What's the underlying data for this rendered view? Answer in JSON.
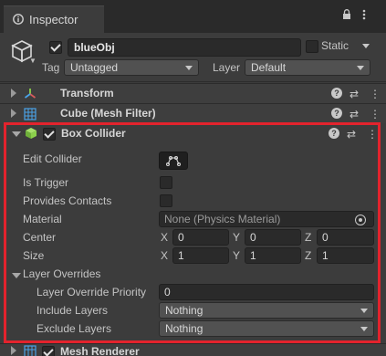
{
  "tab": {
    "title": "Inspector"
  },
  "object": {
    "name": "blueObj",
    "static_label": "Static",
    "tag_label": "Tag",
    "tag_value": "Untagged",
    "layer_label": "Layer",
    "layer_value": "Default"
  },
  "components": [
    {
      "title": "Transform"
    },
    {
      "title": "Cube (Mesh Filter)"
    }
  ],
  "box_collider": {
    "title": "Box Collider",
    "edit_collider_label": "Edit Collider",
    "is_trigger_label": "Is Trigger",
    "provides_contacts_label": "Provides Contacts",
    "material_label": "Material",
    "material_value": "None (Physics Material)",
    "center_label": "Center",
    "center": {
      "x": "0",
      "y": "0",
      "z": "0"
    },
    "size_label": "Size",
    "size": {
      "x": "1",
      "y": "1",
      "z": "1"
    },
    "axis_labels": {
      "x": "X",
      "y": "Y",
      "z": "Z"
    },
    "layer_overrides_label": "Layer Overrides",
    "priority_label": "Layer Override Priority",
    "priority_value": "0",
    "include_label": "Include Layers",
    "include_value": "Nothing",
    "exclude_label": "Exclude Layers",
    "exclude_value": "Nothing"
  },
  "mesh_renderer": {
    "title": "Mesh Renderer"
  },
  "colors": {
    "accent_highlight": "#e3232d",
    "transform_icon": "#d65a5a",
    "meshfilter_icon": "#4aa3e8",
    "boxcollider_icon": "#8bd14b"
  }
}
